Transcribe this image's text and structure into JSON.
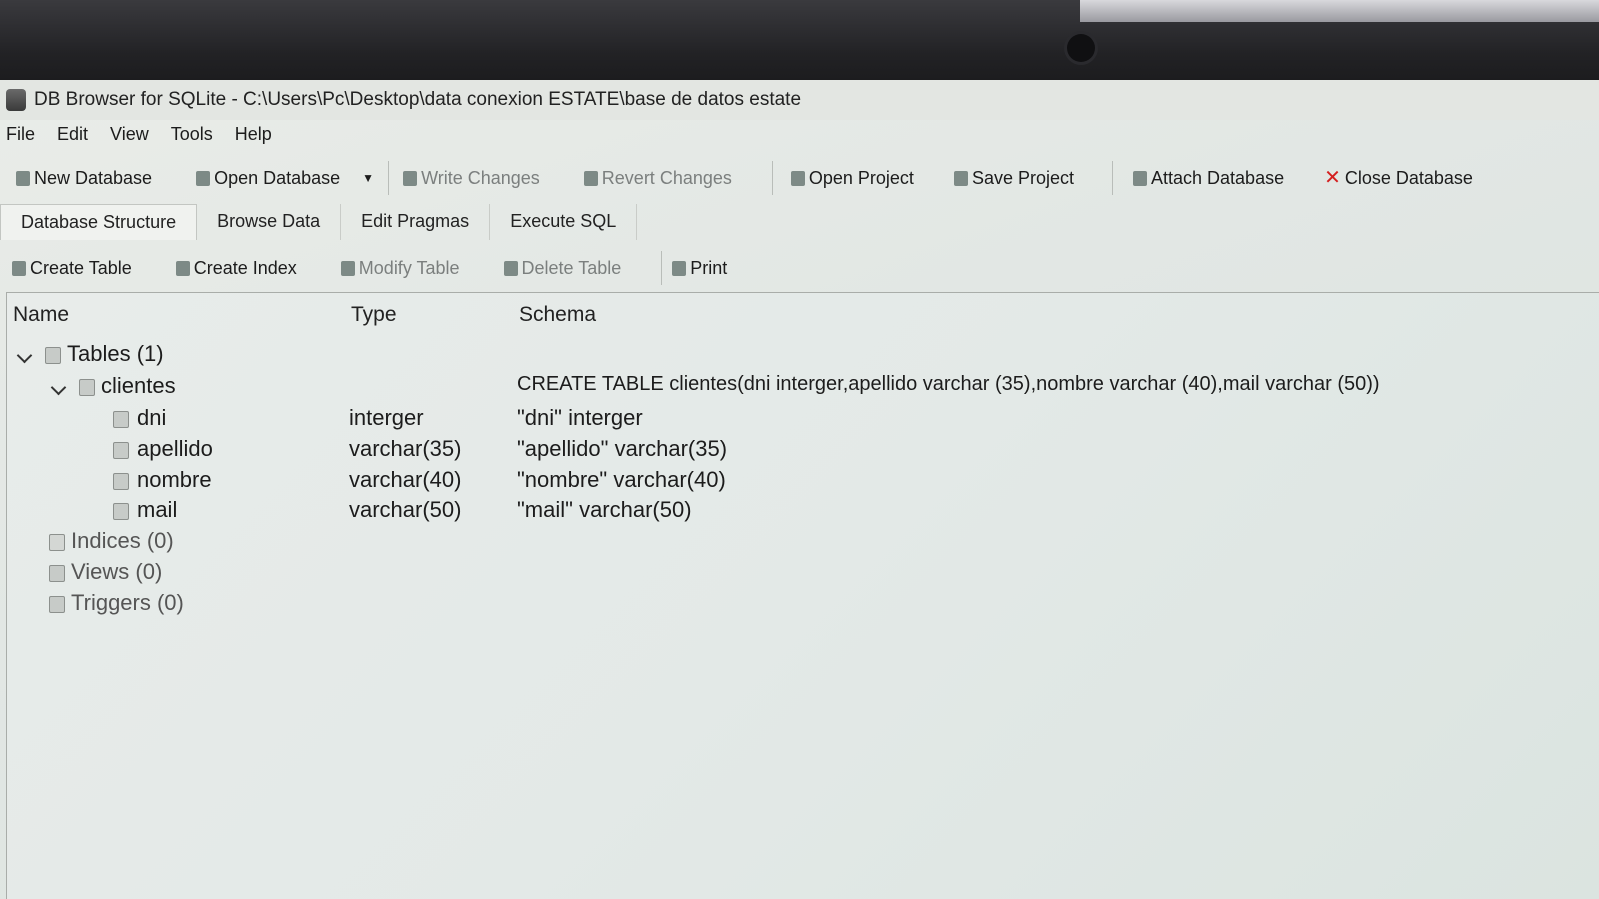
{
  "window": {
    "title": "DB Browser for SQLite - C:\\Users\\Pc\\Desktop\\data conexion ESTATE\\base de datos estate"
  },
  "menu": [
    "File",
    "Edit",
    "View",
    "Tools",
    "Help"
  ],
  "toolbar": {
    "new_database": "New Database",
    "open_database": "Open Database",
    "write_changes": "Write Changes",
    "revert_changes": "Revert Changes",
    "open_project": "Open Project",
    "save_project": "Save Project",
    "attach_database": "Attach Database",
    "close_database": "Close Database"
  },
  "tabs": [
    "Database Structure",
    "Browse Data",
    "Edit Pragmas",
    "Execute SQL"
  ],
  "actions": {
    "create_table": "Create Table",
    "create_index": "Create Index",
    "modify_table": "Modify Table",
    "delete_table": "Delete Table",
    "print": "Print"
  },
  "columns": {
    "name": "Name",
    "type": "Type",
    "schema": "Schema"
  },
  "tree": {
    "tables": "Tables (1)",
    "table": {
      "name": "clientes",
      "schema": "CREATE TABLE clientes(dni interger,apellido varchar (35),nombre varchar (40),mail varchar (50))",
      "fields": [
        {
          "name": "dni",
          "type": "interger",
          "schema": "\"dni\" interger"
        },
        {
          "name": "apellido",
          "type": "varchar(35)",
          "schema": "\"apellido\" varchar(35)"
        },
        {
          "name": "nombre",
          "type": "varchar(40)",
          "schema": "\"nombre\" varchar(40)"
        },
        {
          "name": "mail",
          "type": "varchar(50)",
          "schema": "\"mail\" varchar(50)"
        }
      ]
    },
    "indices": "Indices (0)",
    "views": "Views (0)",
    "triggers": "Triggers (0)"
  }
}
